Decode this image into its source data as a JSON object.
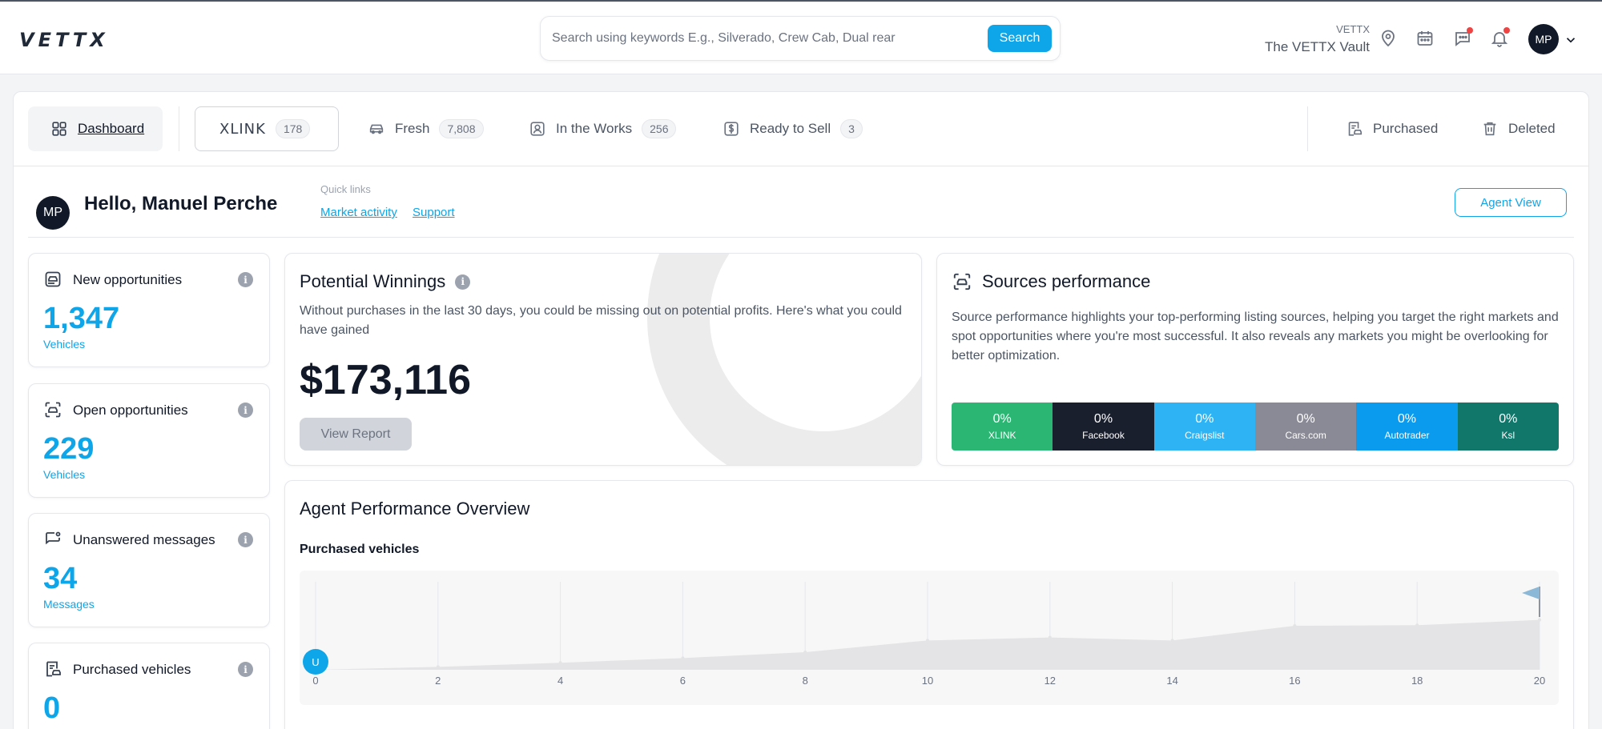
{
  "header": {
    "logo": "VETTX",
    "search_placeholder": "Search using keywords E.g., Silverado, Crew Cab, Dual rear",
    "search_button": "Search",
    "vault_small": "VETTX",
    "vault_name": "The VETTX Vault",
    "avatar_initials": "MP"
  },
  "tabs": {
    "dashboard": "Dashboard",
    "xlink": "XLINK",
    "xlink_count": "178",
    "fresh": "Fresh",
    "fresh_count": "7,808",
    "in_the_works": "In the Works",
    "in_the_works_count": "256",
    "ready_to_sell": "Ready to Sell",
    "ready_to_sell_count": "3",
    "purchased": "Purchased",
    "deleted": "Deleted"
  },
  "greeting": {
    "avatar_initials": "MP",
    "text": "Hello, Manuel Perche",
    "quick_links_label": "Quick links",
    "link_market": "Market activity",
    "link_support": "Support",
    "agent_view": "Agent View"
  },
  "stats": [
    {
      "title": "New opportunities",
      "value": "1,347",
      "unit": "Vehicles",
      "icon": "car-search-icon"
    },
    {
      "title": "Open opportunities",
      "value": "229",
      "unit": "Vehicles",
      "icon": "car-scan-icon"
    },
    {
      "title": "Unanswered messages",
      "value": "34",
      "unit": "Messages",
      "icon": "message-icon"
    },
    {
      "title": "Purchased vehicles",
      "value": "0",
      "unit": "",
      "icon": "receipt-car-icon"
    }
  ],
  "info_glyph": "i",
  "potential": {
    "title": "Potential Winnings",
    "desc": "Without purchases in the last 30 days, you could be missing out on potential profits. Here's what you could have gained",
    "amount": "$173,116",
    "button": "View Report"
  },
  "sources": {
    "title": "Sources performance",
    "desc": "Source performance highlights your top-performing listing sources, helping you target the right markets and spot opportunities where you're most successful. It also reveals any markets you might be overlooking for better optimization.",
    "segments": [
      {
        "pct": "0%",
        "name": "XLINK",
        "color": "#2bb673"
      },
      {
        "pct": "0%",
        "name": "Facebook",
        "color": "#1a1f2e"
      },
      {
        "pct": "0%",
        "name": "Craigslist",
        "color": "#2eb4f5"
      },
      {
        "pct": "0%",
        "name": "Cars.com",
        "color": "#8a8a96"
      },
      {
        "pct": "0%",
        "name": "Autotrader",
        "color": "#0a9bef"
      },
      {
        "pct": "0%",
        "name": "Ksl",
        "color": "#12776b"
      }
    ]
  },
  "agent": {
    "title": "Agent Performance Overview",
    "subtitle": "Purchased vehicles",
    "marker_label": "U"
  },
  "chart_data": {
    "type": "area",
    "x": [
      0,
      2,
      4,
      6,
      8,
      10,
      12,
      14,
      16,
      18,
      20
    ],
    "y": [
      0,
      0.5,
      1.2,
      2,
      3,
      5,
      5.5,
      5,
      7.5,
      7.6,
      8.5
    ],
    "xticks": [
      "0",
      "2",
      "4",
      "6",
      "8",
      "10",
      "12",
      "14",
      "16",
      "18",
      "20"
    ],
    "xlim": [
      0,
      20
    ],
    "ylim": [
      0,
      15
    ],
    "grid": "vertical",
    "fill_color": "#e4e4e6"
  }
}
